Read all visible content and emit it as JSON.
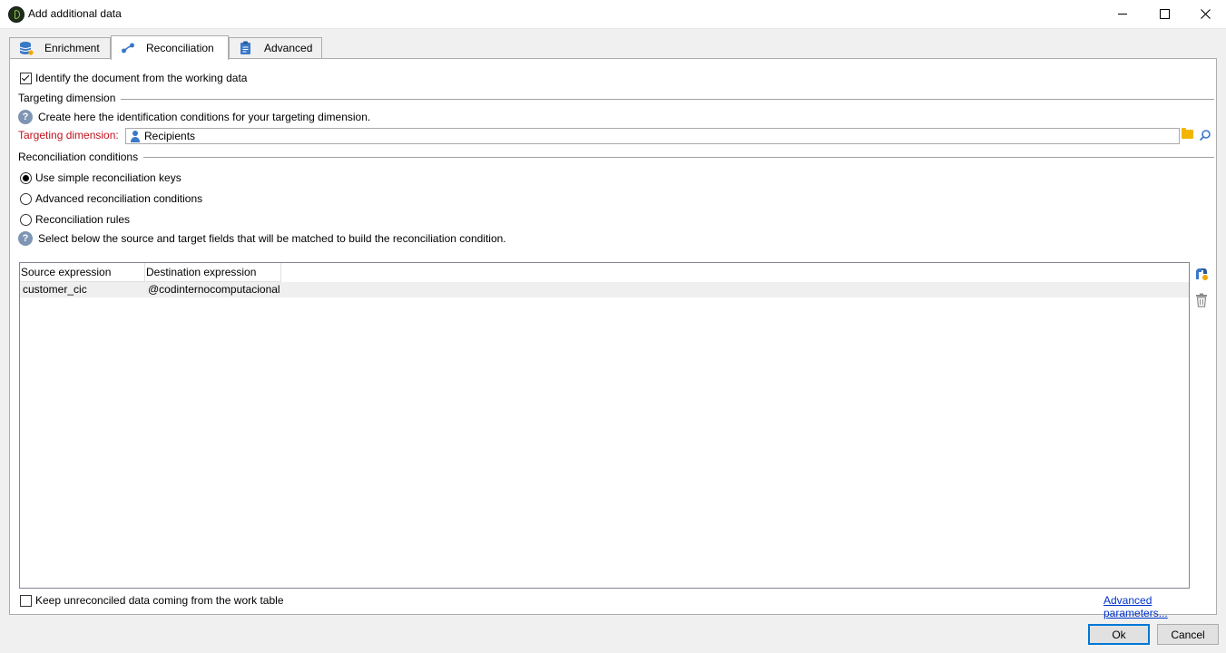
{
  "window": {
    "title": "Add additional data"
  },
  "tabs": [
    {
      "label": "Enrichment",
      "icon": "database-icon"
    },
    {
      "label": "Reconciliation",
      "icon": "link-icon",
      "active": true
    },
    {
      "label": "Advanced",
      "icon": "clipboard-icon"
    }
  ],
  "identify": {
    "label": "Identify the document from the working data",
    "checked": true
  },
  "targeting": {
    "section_title": "Targeting dimension",
    "help_text": "Create here the identification conditions for your targeting dimension.",
    "field_label": "Targeting dimension:",
    "field_value": "Recipients"
  },
  "reconciliation": {
    "section_title": "Reconciliation conditions",
    "options": [
      {
        "label": "Use simple reconciliation keys",
        "selected": true
      },
      {
        "label": "Advanced reconciliation conditions",
        "selected": false
      },
      {
        "label": "Reconciliation rules",
        "selected": false
      }
    ],
    "help_text": "Select below the source and target fields that will be matched to build the reconciliation condition."
  },
  "grid": {
    "columns": [
      "Source expression",
      "Destination expression"
    ],
    "rows": [
      [
        "customer_cic",
        "@codinternocomputacional"
      ]
    ]
  },
  "keep_unreconciled": {
    "label": "Keep unreconciled data coming from the work table",
    "checked": false
  },
  "advanced_link": "Advanced parameters...",
  "buttons": {
    "ok": "Ok",
    "cancel": "Cancel"
  },
  "colors": {
    "required_label": "#c1121f",
    "link": "#0033cc",
    "focus_border": "#0078d7"
  }
}
